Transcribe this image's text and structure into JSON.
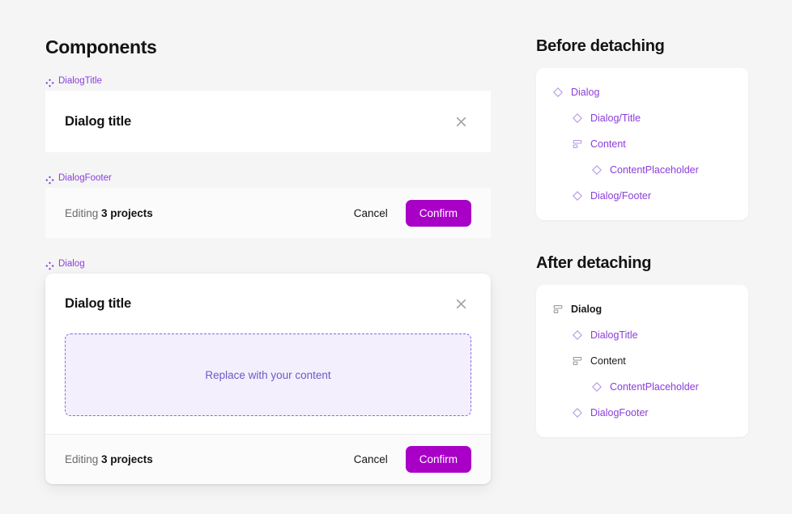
{
  "colors": {
    "background": "#f5f5f5",
    "accent_purple": "#8b3ddb",
    "confirm_button": "#a800c7",
    "placeholder_border": "#8a6ae0",
    "placeholder_fill": "#f4effd",
    "placeholder_text": "#6d5ac4",
    "text_dark": "#141414",
    "text_muted": "#6b6b6b",
    "card_white": "#ffffff",
    "footer_fill": "#fbfbfb"
  },
  "left": {
    "section_title": "Components",
    "components": [
      {
        "badge_label": "DialogTitle",
        "badge_icon": "component-diamond-icon"
      },
      {
        "badge_label": "DialogFooter",
        "badge_icon": "component-diamond-icon"
      },
      {
        "badge_label": "Dialog",
        "badge_icon": "component-diamond-icon"
      }
    ],
    "dialog_title": {
      "title": "Dialog title",
      "close_icon": "close-icon"
    },
    "dialog_footer": {
      "editing_prefix": "Editing ",
      "editing_count": "3 projects",
      "cancel_label": "Cancel",
      "confirm_label": "Confirm"
    },
    "dialog_full": {
      "title": "Dialog title",
      "close_icon": "close-icon",
      "placeholder_text": "Replace with your content",
      "editing_prefix": "Editing ",
      "editing_count": "3 projects",
      "cancel_label": "Cancel",
      "confirm_label": "Confirm"
    }
  },
  "right": {
    "before": {
      "heading": "Before detaching",
      "rows": [
        {
          "label": "Dialog",
          "icon": "component-instance-diamond-icon",
          "depth": 0,
          "style": "purple"
        },
        {
          "label": "Dialog/Title",
          "icon": "component-instance-diamond-icon",
          "depth": 1,
          "style": "purple"
        },
        {
          "label": "Content",
          "icon": "frame-layout-icon",
          "depth": 1,
          "style": "purple"
        },
        {
          "label": "ContentPlaceholder",
          "icon": "component-instance-diamond-icon",
          "depth": 2,
          "style": "purple"
        },
        {
          "label": "Dialog/Footer",
          "icon": "component-instance-diamond-icon",
          "depth": 1,
          "style": "purple"
        }
      ]
    },
    "after": {
      "heading": "After detaching",
      "rows": [
        {
          "label": "Dialog",
          "icon": "frame-layout-icon",
          "depth": 0,
          "style": "dark-bold"
        },
        {
          "label": "DialogTitle",
          "icon": "component-instance-diamond-icon",
          "depth": 1,
          "style": "purple"
        },
        {
          "label": "Content",
          "icon": "frame-layout-icon",
          "depth": 1,
          "style": "dark"
        },
        {
          "label": "ContentPlaceholder",
          "icon": "component-instance-diamond-icon",
          "depth": 2,
          "style": "purple"
        },
        {
          "label": "DialogFooter",
          "icon": "component-instance-diamond-icon",
          "depth": 1,
          "style": "purple"
        }
      ]
    }
  }
}
